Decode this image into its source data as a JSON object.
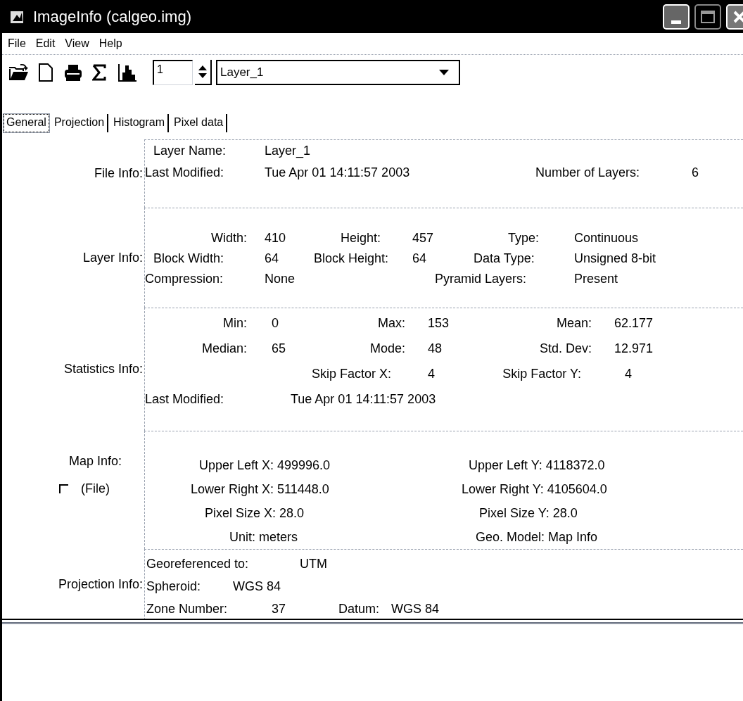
{
  "window": {
    "title": "ImageInfo (calgeo.img)"
  },
  "menu": [
    "File",
    "Edit",
    "View",
    "Help"
  ],
  "toolbar": {
    "layer_number": "1",
    "layer_select": "Layer_1"
  },
  "tabs": [
    {
      "label": "General",
      "selected": true
    },
    {
      "label": "Projection",
      "selected": false
    },
    {
      "label": "Histogram",
      "selected": false
    },
    {
      "label": "Pixel data",
      "selected": false
    }
  ],
  "sections": [
    {
      "title": "File Info:",
      "fields": [
        {
          "label": "Layer Name:",
          "value": "Layer_1"
        },
        {
          "label": "Last Modified:",
          "value": "Tue Apr 01 14:11:57 2003"
        },
        {
          "label": "Number of Layers:",
          "value": "6"
        }
      ]
    },
    {
      "title": "Layer Info:",
      "fields": [
        {
          "label": "Width:",
          "value": "410"
        },
        {
          "label": "Height:",
          "value": "457"
        },
        {
          "label": "Type:",
          "value": "Continuous"
        },
        {
          "label": "Block Width:",
          "value": "64"
        },
        {
          "label": "Block Height:",
          "value": "64"
        },
        {
          "label": "Data Type:",
          "value": "Unsigned 8-bit"
        },
        {
          "label": "Compression:",
          "value": "None"
        },
        {
          "label": "Pyramid Layers:",
          "value": "Present"
        }
      ]
    },
    {
      "title": "Statistics Info:",
      "fields": [
        {
          "label": "Min:",
          "value": "0"
        },
        {
          "label": "Max:",
          "value": "153"
        },
        {
          "label": "Mean:",
          "value": "62.177"
        },
        {
          "label": "Median:",
          "value": "65"
        },
        {
          "label": "Mode:",
          "value": "48"
        },
        {
          "label": "Std. Dev:",
          "value": "12.971"
        },
        {
          "label": "Skip Factor X:",
          "value": "4"
        },
        {
          "label": "Skip Factor Y:",
          "value": "4"
        },
        {
          "label": "Last Modified:",
          "value": "Tue Apr 01 14:11:57 2003"
        }
      ]
    },
    {
      "title": "Map Info:",
      "checkbox": {
        "label": "(File)",
        "checked": false
      },
      "fields": [
        {
          "text": "Upper Left X: 499996.0"
        },
        {
          "text": "Upper Left Y: 4118372.0"
        },
        {
          "text": "Lower Right X: 511448.0"
        },
        {
          "text": "Lower Right Y: 4105604.0"
        },
        {
          "text": "Pixel Size X: 28.0"
        },
        {
          "text": "Pixel Size Y: 28.0"
        },
        {
          "text": "Unit: meters"
        },
        {
          "text": "Geo. Model: Map Info"
        }
      ]
    },
    {
      "title": "Projection Info:",
      "fields": [
        {
          "label": "Georeferenced to:",
          "value": "UTM"
        },
        {
          "label": "Spheroid:",
          "value": "WGS 84"
        },
        {
          "label": "Zone Number:",
          "value": "37"
        },
        {
          "label": "Datum:",
          "value": "WGS 84"
        }
      ]
    }
  ]
}
